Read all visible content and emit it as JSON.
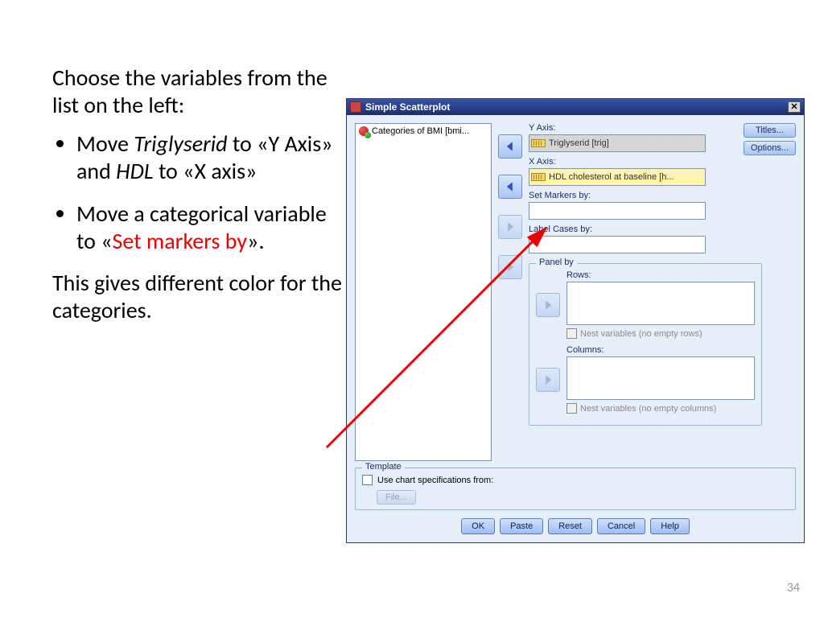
{
  "slide": {
    "intro": "Choose the variables from the list on the left:",
    "b1a": "Move ",
    "b1b": "Triglyserid",
    "b1c": " to «Y Axis» and ",
    "b1d": "HDL",
    "b1e": " to «X axis»",
    "b2a": "Move a categorical variable to «",
    "b2b": "Set markers by",
    "b2c": "».",
    "outro": "This gives different color  for the categories.",
    "page": "34"
  },
  "dialog": {
    "title": "Simple Scatterplot",
    "varlist": {
      "item0": "Categories of BMI [bmi..."
    },
    "sidebtn_titles": "Titles...",
    "sidebtn_options": "Options...",
    "yaxis_label": "Y Axis:",
    "yaxis_value": "Triglyserid  [trig]",
    "xaxis_label": "X Axis:",
    "xaxis_value": "HDL cholesterol at baseline [h...",
    "markers_label": "Set Markers by:",
    "cases_label": "Label Cases by:",
    "panel_title": "Panel by",
    "rows_label": "Rows:",
    "cols_label": "Columns:",
    "nest_rows": "Nest variables (no empty rows)",
    "nest_cols": "Nest variables (no empty columns)",
    "template_title": "Template",
    "template_chk": "Use chart specifications from:",
    "file_btn": "File...",
    "ok": "OK",
    "paste": "Paste",
    "reset": "Reset",
    "cancel": "Cancel",
    "help": "Help"
  }
}
